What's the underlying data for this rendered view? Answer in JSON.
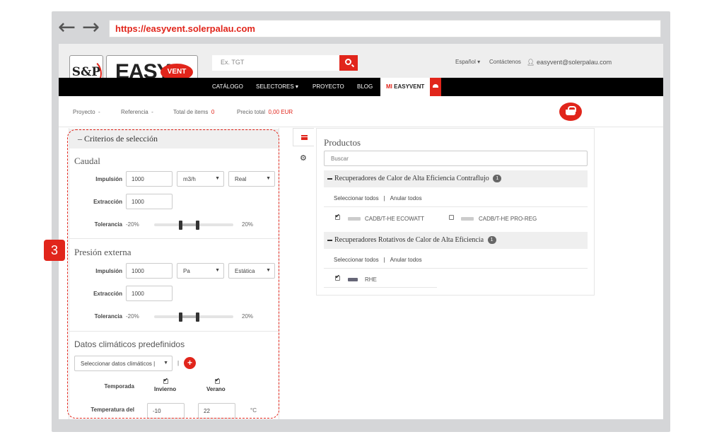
{
  "browser": {
    "url": "https://easyvent.solerpalau.com"
  },
  "header": {
    "logo_sp": "S&P",
    "logo_easy": "EASY",
    "logo_vent": "VENT",
    "search_placeholder": "Ex. TGT",
    "language": "Español ▾",
    "contact": "Contáctenos",
    "user_email": "easyvent@solerpalau.com"
  },
  "menu": {
    "catalogo": "CATÁLOGO",
    "selectores": "SELECTORES ▾",
    "proyecto": "PROYECTO",
    "blog": "BLOG",
    "mi": "MI",
    "easyvent": "EASYVENT"
  },
  "project_bar": {
    "proyecto": "Proyecto",
    "proyecto_val": "-",
    "referencia": "Referencia",
    "referencia_val": "-",
    "total_items": "Total de items",
    "total_items_val": "0",
    "precio_total": "Precio total",
    "precio_total_val": "0,00 EUR"
  },
  "criteria": {
    "header": "Criterios de selección",
    "caudal": {
      "title": "Caudal",
      "impulsion_label": "Impulsión",
      "impulsion_value": "1000",
      "unit": "m3/h",
      "mode": "Real",
      "extraccion_label": "Extracción",
      "extraccion_value": "1000",
      "tolerancia_label": "Tolerancia",
      "tol_min": "-20%",
      "tol_max": "20%"
    },
    "presion": {
      "title": "Presión externa",
      "impulsion_label": "Impulsión",
      "impulsion_value": "1000",
      "unit": "Pa",
      "mode": "Estática",
      "extraccion_label": "Extracción",
      "extraccion_value": "1000",
      "tolerancia_label": "Tolerancia",
      "tol_min": "-20%",
      "tol_max": "20%"
    },
    "clima": {
      "title": "Datos climáticos predefinidos",
      "select_placeholder": "Seleccionar datos climáticos |",
      "separator": "|",
      "plus": "+",
      "temporada_label": "Temporada",
      "invierno": "Invierno",
      "verano": "Verano",
      "temperatura_label": "Temperatura del",
      "invierno_temp": "-10",
      "verano_temp": "22",
      "unit": "°C"
    }
  },
  "step_badge": "3",
  "products": {
    "title": "Productos",
    "search_placeholder": "Buscar",
    "groups": [
      {
        "title": "Recuperadores de Calor de Alta Eficiencia Contraflujo",
        "count": "1",
        "select_all": "Seleccionar todos",
        "separator": "|",
        "deselect_all": "Anular todos",
        "items": [
          {
            "name": "CADB/T-HE ECOWATT",
            "checked": true
          },
          {
            "name": "CADB/T-HE PRO-REG",
            "checked": false
          }
        ]
      },
      {
        "title": "Recuperadores Rotativos de Calor de Alta Eficiencia",
        "count": "1",
        "select_all": "Seleccionar todos",
        "separator": "|",
        "deselect_all": "Anular todos",
        "items": [
          {
            "name": "RHE",
            "checked": true
          }
        ]
      }
    ]
  },
  "colors": {
    "brand_red": "#e1251b",
    "menu_black": "#000000"
  }
}
